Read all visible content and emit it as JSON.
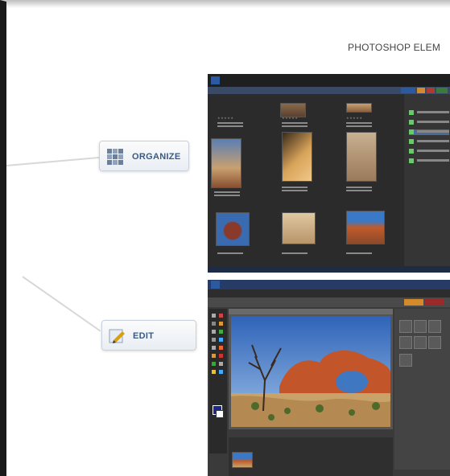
{
  "header": {
    "title": "PHOTOSHOP ELEM"
  },
  "callouts": [
    {
      "label": "ORGANIZE",
      "icon": "grid-icon"
    },
    {
      "label": "EDIT",
      "icon": "pencil-icon"
    }
  ],
  "colors": {
    "label_blue": "#3a5a84",
    "dark_ui": "#2b2b2b",
    "accent_blue": "#2c5aa0"
  }
}
